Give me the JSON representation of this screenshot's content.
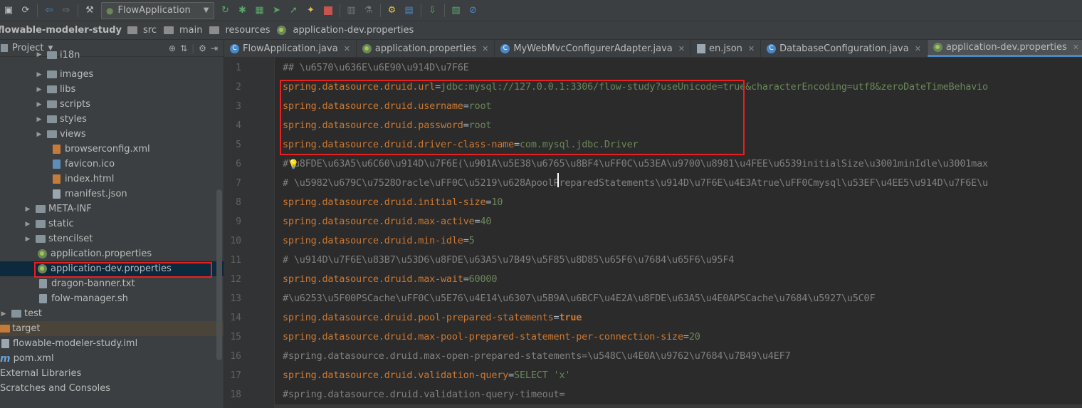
{
  "toolbar": {
    "run_config": "FlowApplication",
    "icons": [
      "save-icon",
      "sync-icon",
      "back-icon",
      "forward-icon",
      "build-icon",
      "run-icon",
      "debug-icon",
      "coverage-icon",
      "profile-icon",
      "stop-icon",
      "structure-icon",
      "maven-icon",
      "settings-icon",
      "project-structure-icon",
      "terminal-icon",
      "update-icon",
      "no-icon"
    ]
  },
  "breadcrumb": {
    "items": [
      "flowable-modeler-study",
      "src",
      "main",
      "resources",
      "application-dev.properties"
    ]
  },
  "project": {
    "title": "Project",
    "tree": [
      {
        "label": "i18n",
        "kind": "folder",
        "expandable": true
      },
      {
        "label": "images",
        "kind": "folder",
        "expandable": true
      },
      {
        "label": "libs",
        "kind": "folder",
        "expandable": true
      },
      {
        "label": "scripts",
        "kind": "folder",
        "expandable": true
      },
      {
        "label": "styles",
        "kind": "folder",
        "expandable": true
      },
      {
        "label": "views",
        "kind": "folder",
        "expandable": true
      },
      {
        "label": "browserconfig.xml",
        "kind": "xml"
      },
      {
        "label": "favicon.ico",
        "kind": "file"
      },
      {
        "label": "index.html",
        "kind": "html"
      },
      {
        "label": "manifest.json",
        "kind": "json"
      },
      {
        "label": "META-INF",
        "kind": "folder",
        "expandable": true
      },
      {
        "label": "static",
        "kind": "folder",
        "expandable": true
      },
      {
        "label": "stencilset",
        "kind": "folder",
        "expandable": true
      },
      {
        "label": "application.properties",
        "kind": "properties"
      },
      {
        "label": "application-dev.properties",
        "kind": "properties",
        "selected": true
      },
      {
        "label": "dragon-banner.txt",
        "kind": "txt"
      },
      {
        "label": "folw-manager.sh",
        "kind": "sh"
      },
      {
        "label": "test",
        "kind": "folder",
        "expandable": true
      },
      {
        "label": "target",
        "kind": "folder-orange"
      },
      {
        "label": "flowable-modeler-study.iml",
        "kind": "iml"
      },
      {
        "label": "pom.xml",
        "kind": "maven"
      },
      {
        "label": "External Libraries",
        "kind": "lib"
      },
      {
        "label": "Scratches and Consoles",
        "kind": "scratch"
      }
    ]
  },
  "tabs": [
    {
      "label": "FlowApplication.java",
      "icon": "class-icon"
    },
    {
      "label": "application.properties",
      "icon": "spring-icon"
    },
    {
      "label": "MyWebMvcConfigurerAdapter.java",
      "icon": "class-icon"
    },
    {
      "label": "en.json",
      "icon": "json-icon"
    },
    {
      "label": "DatabaseConfiguration.java",
      "icon": "class-icon"
    },
    {
      "label": "application-dev.properties",
      "icon": "spring-icon",
      "active": true
    }
  ],
  "editor": {
    "line_numbers": [
      "1",
      "2",
      "3",
      "4",
      "5",
      "6",
      "7",
      "8",
      "9",
      "10",
      "11",
      "12",
      "13",
      "14",
      "15",
      "16",
      "17",
      "18"
    ],
    "lines": [
      {
        "type": "comment",
        "text": "## \\u6570\\u636E\\u6E90\\u914D\\u7F6E"
      },
      {
        "type": "prop",
        "key": "spring.datasource.druid.url",
        "value": "jdbc:mysql://127.0.0.1:3306/flow-study?useUnicode=true&characterEncoding=utf8&zeroDateTimeBehavio"
      },
      {
        "type": "prop",
        "key": "spring.datasource.druid.username",
        "value": "root"
      },
      {
        "type": "prop",
        "key": "spring.datasource.druid.password",
        "value": "root"
      },
      {
        "type": "prop",
        "key": "spring.datasource.druid.driver-class-name",
        "value": "com.mysql.jdbc.Driver"
      },
      {
        "type": "comment",
        "text": "#\\u8FDE\\u63A5\\u6C60\\u914D\\u7F6E(\\u901A\\u5E38\\u6765\\u8BF4\\uFF0C\\u53EA\\u9700\\u8981\\u4FEE\\u6539initialSize\\u3001minIdle\\u3001max"
      },
      {
        "type": "comment",
        "text": "# \\u5982\\u679C\\u7528Oracle\\uFF0C\\u5219\\u628ApoolPreparedStatements\\u914D\\u7F6E\\u4E3Atrue\\uFF0Cmysql\\u53EF\\u4EE5\\u914D\\u7F6E\\u"
      },
      {
        "type": "prop",
        "key": "spring.datasource.druid.initial-size",
        "value": "10"
      },
      {
        "type": "prop",
        "key": "spring.datasource.druid.max-active",
        "value": "40"
      },
      {
        "type": "prop",
        "key": "spring.datasource.druid.min-idle",
        "value": "5"
      },
      {
        "type": "comment",
        "text": "# \\u914D\\u7F6E\\u83B7\\u53D6\\u8FDE\\u63A5\\u7B49\\u5F85\\u8D85\\u65F6\\u7684\\u65F6\\u95F4"
      },
      {
        "type": "prop",
        "key": "spring.datasource.druid.max-wait",
        "value": "60000"
      },
      {
        "type": "comment",
        "text": "#\\u6253\\u5F00PSCache\\uFF0C\\u5E76\\u4E14\\u6307\\u5B9A\\u6BCF\\u4E2A\\u8FDE\\u63A5\\u4E0APSCache\\u7684\\u5927\\u5C0F"
      },
      {
        "type": "prop-bool",
        "key": "spring.datasource.druid.pool-prepared-statements",
        "value": "true"
      },
      {
        "type": "prop",
        "key": "spring.datasource.druid.max-pool-prepared-statement-per-connection-size",
        "value": "20"
      },
      {
        "type": "comment",
        "text": "#spring.datasource.druid.max-open-prepared-statements=\\u548C\\u4E0A\\u9762\\u7684\\u7B49\\u4EF7"
      },
      {
        "type": "prop",
        "key": "spring.datasource.druid.validation-query",
        "value": "SELECT 'x'"
      },
      {
        "type": "comment",
        "text": "#spring.datasource.druid.validation-query-timeout="
      }
    ]
  },
  "colors": {
    "key": "#cc7832",
    "value": "#6a8759",
    "comment": "#808080",
    "highlight_box": "#e8201f"
  }
}
